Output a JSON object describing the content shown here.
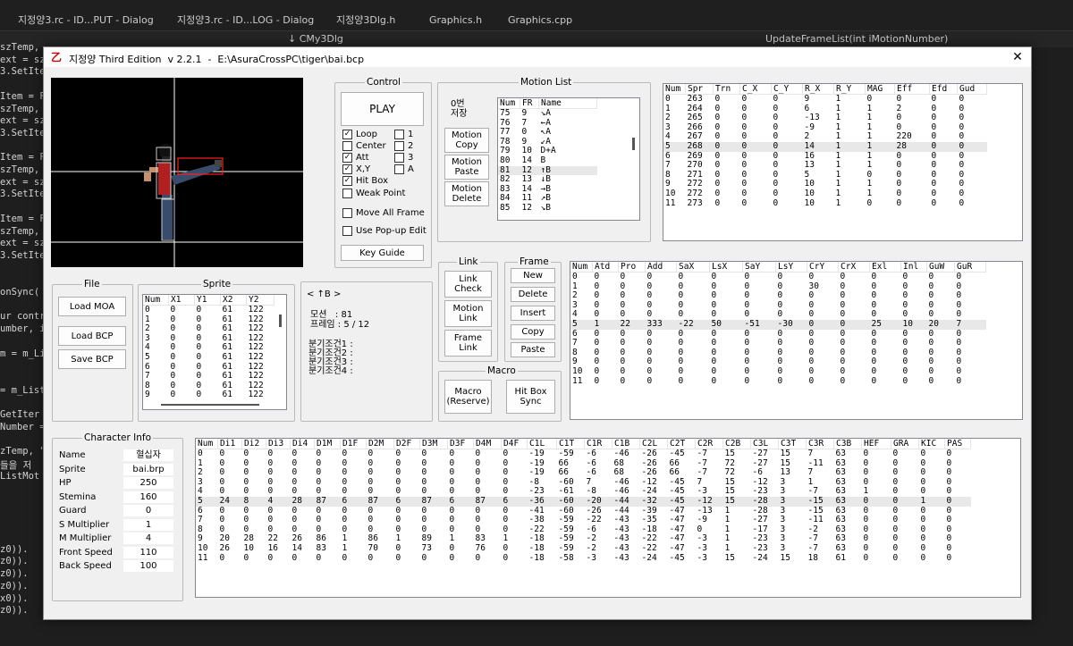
{
  "ide": {
    "tabs": [
      "지정양3.rc - ID...PUT - Dialog",
      "지정양3.rc - ID...LOG - Dialog",
      "지정양3Dlg.h",
      "Graphics.h",
      "Graphics.cpp"
    ],
    "nav_left": "↓ CMy3Dlg",
    "nav_right": "UpdateFrameList(int iMotionNumber)",
    "code_lines": [
      "szTemp,",
      "ext = sz",
      "3.SetIte",
      "",
      "Item = FR",
      "szTemp, ",
      "ext = sz",
      "3.SetIte",
      "",
      "Item = FR",
      "szTemp, ",
      "ext = sz",
      "3.SetIte",
      "",
      "Item = FR",
      "szTemp, ",
      "ext = sz",
      "3.SetIte",
      "",
      "",
      "onSync(",
      "",
      "ur contr",
      "umber, i",
      "",
      "m = m_Lis",
      "",
      "",
      "= m_List",
      "",
      "GetIter",
      "Number =",
      "",
      "zTemp, \"",
      "들을 저",
      "ListMot",
      "",
      "",
      "",
      "",
      "",
      "z0)).",
      "z0)).",
      "z0)).",
      "z0)).",
      "x0)).",
      "z0))."
    ]
  },
  "dialog": {
    "title": "지정양 Third Edition  v 2.2.1  -  E:\\AsuraCrossPC\\tiger\\bai.bcp",
    "close": "✕"
  },
  "control": {
    "label": "Control",
    "play": "PLAY",
    "checks": [
      {
        "label": "Loop",
        "checked": true
      },
      {
        "label": "Center",
        "checked": false
      },
      {
        "label": "Att",
        "checked": true
      },
      {
        "label": "X,Y",
        "checked": true
      },
      {
        "label": "Hit Box",
        "checked": true
      },
      {
        "label": "Weak Point",
        "checked": false
      }
    ],
    "num_checks": [
      {
        "label": "1",
        "checked": false
      },
      {
        "label": "2",
        "checked": false
      },
      {
        "label": "3",
        "checked": false
      },
      {
        "label": "A",
        "checked": false
      }
    ],
    "move_all": {
      "label": "Move All Frame",
      "checked": false
    },
    "popup": {
      "label": "Use Pop-up Edit",
      "checked": false
    },
    "key_guide": "Key Guide"
  },
  "motion_list": {
    "label": "Motion List",
    "side_label": "0번\n저장",
    "buttons": [
      "Motion\nCopy",
      "Motion\nPaste",
      "Motion\nDelete"
    ],
    "headers": [
      "Num",
      "FR",
      "Name"
    ],
    "rows": [
      [
        "75",
        "9",
        "↘A"
      ],
      [
        "76",
        "7",
        "←A"
      ],
      [
        "77",
        "0",
        "↖A"
      ],
      [
        "78",
        "9",
        "↙A"
      ],
      [
        "79",
        "10",
        "D+A"
      ],
      [
        "80",
        "14",
        "B"
      ],
      [
        "81",
        "12",
        "↑B"
      ],
      [
        "82",
        "13",
        "↓B"
      ],
      [
        "83",
        "14",
        "→B"
      ],
      [
        "84",
        "11",
        "↗B"
      ],
      [
        "85",
        "12",
        "↘B"
      ]
    ],
    "selected_index": 6
  },
  "frame_table": {
    "headers": [
      "Num",
      "Spr",
      "Trn",
      "C_X",
      "C_Y",
      "R_X",
      "R_Y",
      "MAG",
      "Eff",
      "Efd",
      "Gud"
    ],
    "rows": [
      [
        "0",
        "263",
        "0",
        "0",
        "0",
        "9",
        "1",
        "0",
        "0",
        "0",
        "0"
      ],
      [
        "1",
        "264",
        "0",
        "0",
        "0",
        "6",
        "1",
        "1",
        "2",
        "0",
        "0"
      ],
      [
        "2",
        "265",
        "0",
        "0",
        "0",
        "-13",
        "1",
        "1",
        "0",
        "0",
        "0"
      ],
      [
        "3",
        "266",
        "0",
        "0",
        "0",
        "-9",
        "1",
        "1",
        "0",
        "0",
        "0"
      ],
      [
        "4",
        "267",
        "0",
        "0",
        "0",
        "2",
        "1",
        "1",
        "220",
        "0",
        "0"
      ],
      [
        "5",
        "268",
        "0",
        "0",
        "0",
        "14",
        "1",
        "1",
        "28",
        "0",
        "0"
      ],
      [
        "6",
        "269",
        "0",
        "0",
        "0",
        "16",
        "1",
        "1",
        "0",
        "0",
        "0"
      ],
      [
        "7",
        "270",
        "0",
        "0",
        "0",
        "13",
        "1",
        "1",
        "0",
        "0",
        "0"
      ],
      [
        "8",
        "271",
        "0",
        "0",
        "0",
        "5",
        "1",
        "0",
        "0",
        "0",
        "0"
      ],
      [
        "9",
        "272",
        "0",
        "0",
        "0",
        "10",
        "1",
        "1",
        "0",
        "0",
        "0"
      ],
      [
        "10",
        "272",
        "0",
        "0",
        "0",
        "10",
        "1",
        "1",
        "0",
        "0",
        "0"
      ],
      [
        "11",
        "273",
        "0",
        "0",
        "0",
        "10",
        "1",
        "0",
        "0",
        "0",
        "0"
      ]
    ],
    "highlight_index": 5
  },
  "file": {
    "label": "File",
    "buttons": [
      "Load MOA",
      "Load BCP",
      "Save BCP"
    ]
  },
  "sprite": {
    "label": "Sprite",
    "headers": [
      "Num",
      "X1",
      "Y1",
      "X2",
      "Y2"
    ],
    "rows": [
      [
        "0",
        "0",
        "0",
        "61",
        "122"
      ],
      [
        "1",
        "0",
        "0",
        "61",
        "122"
      ],
      [
        "2",
        "0",
        "0",
        "61",
        "122"
      ],
      [
        "3",
        "0",
        "0",
        "61",
        "122"
      ],
      [
        "4",
        "0",
        "0",
        "61",
        "122"
      ],
      [
        "5",
        "0",
        "0",
        "61",
        "122"
      ],
      [
        "6",
        "0",
        "0",
        "61",
        "122"
      ],
      [
        "7",
        "0",
        "0",
        "61",
        "122"
      ],
      [
        "8",
        "0",
        "0",
        "61",
        "122"
      ],
      [
        "9",
        "0",
        "0",
        "61",
        "122"
      ]
    ]
  },
  "info": {
    "current": "< ↑B >",
    "motion": "모션   : 81",
    "frame": "프레임 : 5 / 12",
    "branches": [
      "분기조건1 :",
      "분기조건2 :",
      "분기조건3 :",
      "분기조건4 :"
    ]
  },
  "link": {
    "label": "Link",
    "buttons": [
      "Link\nCheck",
      "Motion\nLink",
      "Frame\nLink"
    ]
  },
  "frame_group": {
    "label": "Frame",
    "buttons": [
      "New",
      "Delete",
      "Insert",
      "Copy",
      "Paste"
    ]
  },
  "macro": {
    "label": "Macro",
    "buttons": [
      "Macro\n(Reserve)",
      "Hit Box\nSync"
    ]
  },
  "attack_table": {
    "headers": [
      "Num",
      "Atd",
      "Pro",
      "Add",
      "SaX",
      "LsX",
      "SaY",
      "LsY",
      "CrY",
      "CrX",
      "Exl",
      "Inl",
      "GuW",
      "GuR"
    ],
    "rows": [
      [
        "0",
        "0",
        "0",
        "0",
        "0",
        "0",
        "0",
        "0",
        "0",
        "0",
        "0",
        "0",
        "0",
        "0"
      ],
      [
        "1",
        "0",
        "0",
        "0",
        "0",
        "0",
        "0",
        "0",
        "30",
        "0",
        "0",
        "0",
        "0",
        "0"
      ],
      [
        "2",
        "0",
        "0",
        "0",
        "0",
        "0",
        "0",
        "0",
        "0",
        "0",
        "0",
        "0",
        "0",
        "0"
      ],
      [
        "3",
        "0",
        "0",
        "0",
        "0",
        "0",
        "0",
        "0",
        "0",
        "0",
        "0",
        "0",
        "0",
        "0"
      ],
      [
        "4",
        "0",
        "0",
        "0",
        "0",
        "0",
        "0",
        "0",
        "0",
        "0",
        "0",
        "0",
        "0",
        "0"
      ],
      [
        "5",
        "1",
        "22",
        "333",
        "-22",
        "50",
        "-51",
        "-30",
        "0",
        "0",
        "25",
        "10",
        "20",
        "7"
      ],
      [
        "6",
        "0",
        "0",
        "0",
        "0",
        "0",
        "0",
        "0",
        "0",
        "0",
        "0",
        "0",
        "0",
        "0"
      ],
      [
        "7",
        "0",
        "0",
        "0",
        "0",
        "0",
        "0",
        "0",
        "0",
        "0",
        "0",
        "0",
        "0",
        "0"
      ],
      [
        "8",
        "0",
        "0",
        "0",
        "0",
        "0",
        "0",
        "0",
        "0",
        "0",
        "0",
        "0",
        "0",
        "0"
      ],
      [
        "9",
        "0",
        "0",
        "0",
        "0",
        "0",
        "0",
        "0",
        "0",
        "0",
        "0",
        "0",
        "0",
        "0"
      ],
      [
        "10",
        "0",
        "0",
        "0",
        "0",
        "0",
        "0",
        "0",
        "0",
        "0",
        "0",
        "0",
        "0",
        "0"
      ],
      [
        "11",
        "0",
        "0",
        "0",
        "0",
        "0",
        "0",
        "0",
        "0",
        "0",
        "0",
        "0",
        "0",
        "0"
      ]
    ],
    "highlight_index": 5
  },
  "character": {
    "label": "Character Info",
    "fields": [
      {
        "label": "Name",
        "value": "혈십자"
      },
      {
        "label": "Sprite",
        "value": "bai.brp"
      },
      {
        "label": "HP",
        "value": "250"
      },
      {
        "label": "Stemina",
        "value": "160"
      },
      {
        "label": "Guard",
        "value": "0"
      },
      {
        "label": "S Multiplier",
        "value": "1"
      },
      {
        "label": "M Multiplier",
        "value": "4"
      },
      {
        "label": "Front Speed",
        "value": "110"
      },
      {
        "label": "Back Speed",
        "value": "100"
      }
    ]
  },
  "box_table": {
    "headers": [
      "Num",
      "Di1",
      "Di2",
      "Di3",
      "Di4",
      "D1M",
      "D1F",
      "D2M",
      "D2F",
      "D3M",
      "D3F",
      "D4M",
      "D4F",
      "C1L",
      "C1T",
      "C1R",
      "C1B",
      "C2L",
      "C2T",
      "C2R",
      "C2B",
      "C3L",
      "C3T",
      "C3R",
      "C3B",
      "HEF",
      "GRA",
      "KIC",
      "PAS"
    ],
    "rows": [
      [
        "0",
        "0",
        "0",
        "0",
        "0",
        "0",
        "0",
        "0",
        "0",
        "0",
        "0",
        "0",
        "0",
        "-19",
        "-59",
        "-6",
        "-46",
        "-26",
        "-45",
        "-7",
        "15",
        "-27",
        "15",
        "7",
        "63",
        "0",
        "0",
        "0",
        "0"
      ],
      [
        "1",
        "0",
        "0",
        "0",
        "0",
        "0",
        "0",
        "0",
        "0",
        "0",
        "0",
        "0",
        "0",
        "-19",
        "66",
        "-6",
        "68",
        "-26",
        "66",
        "-7",
        "72",
        "-27",
        "15",
        "-11",
        "63",
        "0",
        "0",
        "0",
        "0"
      ],
      [
        "2",
        "0",
        "0",
        "0",
        "0",
        "0",
        "0",
        "0",
        "0",
        "0",
        "0",
        "0",
        "0",
        "-19",
        "66",
        "-6",
        "68",
        "-26",
        "66",
        "-7",
        "72",
        "-6",
        "13",
        "7",
        "63",
        "0",
        "0",
        "0",
        "0"
      ],
      [
        "3",
        "0",
        "0",
        "0",
        "0",
        "0",
        "0",
        "0",
        "0",
        "0",
        "0",
        "0",
        "0",
        "-8",
        "-60",
        "7",
        "-46",
        "-12",
        "-45",
        "7",
        "15",
        "-12",
        "3",
        "1",
        "63",
        "0",
        "0",
        "0",
        "0"
      ],
      [
        "4",
        "0",
        "0",
        "0",
        "0",
        "0",
        "0",
        "0",
        "0",
        "0",
        "0",
        "0",
        "0",
        "-23",
        "-61",
        "-8",
        "-46",
        "-24",
        "-45",
        "-3",
        "15",
        "-23",
        "3",
        "-7",
        "63",
        "1",
        "0",
        "0",
        "0"
      ],
      [
        "5",
        "24",
        "8",
        "4",
        "28",
        "87",
        "6",
        "87",
        "6",
        "87",
        "6",
        "87",
        "6",
        "-36",
        "-60",
        "-20",
        "-44",
        "-32",
        "-45",
        "-12",
        "15",
        "-28",
        "3",
        "-15",
        "63",
        "0",
        "0",
        "1",
        "0"
      ],
      [
        "6",
        "0",
        "0",
        "0",
        "0",
        "0",
        "0",
        "0",
        "0",
        "0",
        "0",
        "0",
        "0",
        "-41",
        "-60",
        "-26",
        "-44",
        "-39",
        "-47",
        "-13",
        "1",
        "-28",
        "3",
        "-15",
        "63",
        "0",
        "0",
        "0",
        "0"
      ],
      [
        "7",
        "0",
        "0",
        "0",
        "0",
        "0",
        "0",
        "0",
        "0",
        "0",
        "0",
        "0",
        "0",
        "-38",
        "-59",
        "-22",
        "-43",
        "-35",
        "-47",
        "-9",
        "1",
        "-27",
        "3",
        "-11",
        "63",
        "0",
        "0",
        "0",
        "0"
      ],
      [
        "8",
        "0",
        "0",
        "0",
        "0",
        "0",
        "0",
        "0",
        "0",
        "0",
        "0",
        "0",
        "0",
        "-22",
        "-59",
        "-6",
        "-43",
        "-18",
        "-47",
        "0",
        "1",
        "-17",
        "3",
        "-2",
        "63",
        "0",
        "0",
        "0",
        "0"
      ],
      [
        "9",
        "20",
        "28",
        "22",
        "26",
        "86",
        "1",
        "86",
        "1",
        "89",
        "1",
        "83",
        "1",
        "-18",
        "-59",
        "-2",
        "-43",
        "-22",
        "-47",
        "-3",
        "1",
        "-23",
        "3",
        "-7",
        "63",
        "0",
        "0",
        "0",
        "0"
      ],
      [
        "10",
        "26",
        "10",
        "16",
        "14",
        "83",
        "1",
        "70",
        "0",
        "73",
        "0",
        "76",
        "0",
        "-18",
        "-59",
        "-2",
        "-43",
        "-22",
        "-47",
        "-3",
        "1",
        "-23",
        "3",
        "-7",
        "63",
        "0",
        "0",
        "0",
        "0"
      ],
      [
        "11",
        "0",
        "0",
        "0",
        "0",
        "0",
        "0",
        "0",
        "0",
        "0",
        "0",
        "0",
        "0",
        "-18",
        "-58",
        "-3",
        "-43",
        "-24",
        "-45",
        "-3",
        "15",
        "-24",
        "15",
        "18",
        "61",
        "0",
        "0",
        "0",
        "0"
      ]
    ],
    "highlight_index": 5
  },
  "colors": {
    "accent": "#c00000",
    "hitbox": "#ff2020",
    "preview_bg": "#000000"
  }
}
